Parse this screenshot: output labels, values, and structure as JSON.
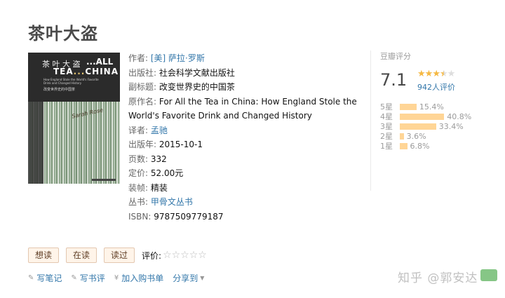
{
  "book": {
    "title": "茶叶大盗",
    "cover": {
      "cn_title": "茶 叶 大 盗",
      "en_line1": "...ALL",
      "en_line2a": "TEA",
      "en_line2b": "CHINA",
      "en_small": "How England Stole the World's Favorite Drink and Changed History",
      "cn_subtitle": "改变世界史的中国茶",
      "signature": "Sarah Rose"
    },
    "info": [
      {
        "label": "作者: ",
        "value": "[美] 萨拉·罗斯",
        "link": true
      },
      {
        "label": "出版社: ",
        "value": "社会科学文献出版社",
        "link": false
      },
      {
        "label": "副标题: ",
        "value": "改变世界史的中国茶",
        "link": false
      },
      {
        "label": "原作名: ",
        "value": "For All the Tea in China: How England Stole the",
        "link": false
      },
      {
        "label": "",
        "value": "World's Favorite Drink and Changed History",
        "link": false
      },
      {
        "label": "译者: ",
        "value": "孟驰",
        "link": true
      },
      {
        "label": "出版年: ",
        "value": "2015-10-1",
        "link": false
      },
      {
        "label": "页数: ",
        "value": "332",
        "link": false
      },
      {
        "label": "定价: ",
        "value": "52.00元",
        "link": false
      },
      {
        "label": "装帧: ",
        "value": "精装",
        "link": false
      },
      {
        "label": "丛书: ",
        "value": "甲骨文丛书",
        "link": true
      },
      {
        "label": "ISBN: ",
        "value": "9787509779187",
        "link": false
      }
    ]
  },
  "rating": {
    "title": "豆瓣评分",
    "score": "7.1",
    "stars_value": 3.5,
    "count": "942人评价",
    "breakdown": [
      {
        "label": "5星",
        "pct": "15.4%",
        "value": 15.4
      },
      {
        "label": "4星",
        "pct": "40.8%",
        "value": 40.8
      },
      {
        "label": "3星",
        "pct": "33.4%",
        "value": 33.4
      },
      {
        "label": "2星",
        "pct": "3.6%",
        "value": 3.6
      },
      {
        "label": "1星",
        "pct": "6.8%",
        "value": 6.8
      }
    ]
  },
  "actions": {
    "want": "想读",
    "reading": "在读",
    "read": "读过",
    "rate_label": "评价:",
    "empty_stars": "☆☆☆☆☆"
  },
  "links": {
    "write_note": "写笔记",
    "write_review": "写书评",
    "add_cart": "加入购书单",
    "share": "分享到"
  },
  "watermark": "知乎 @郭安达"
}
